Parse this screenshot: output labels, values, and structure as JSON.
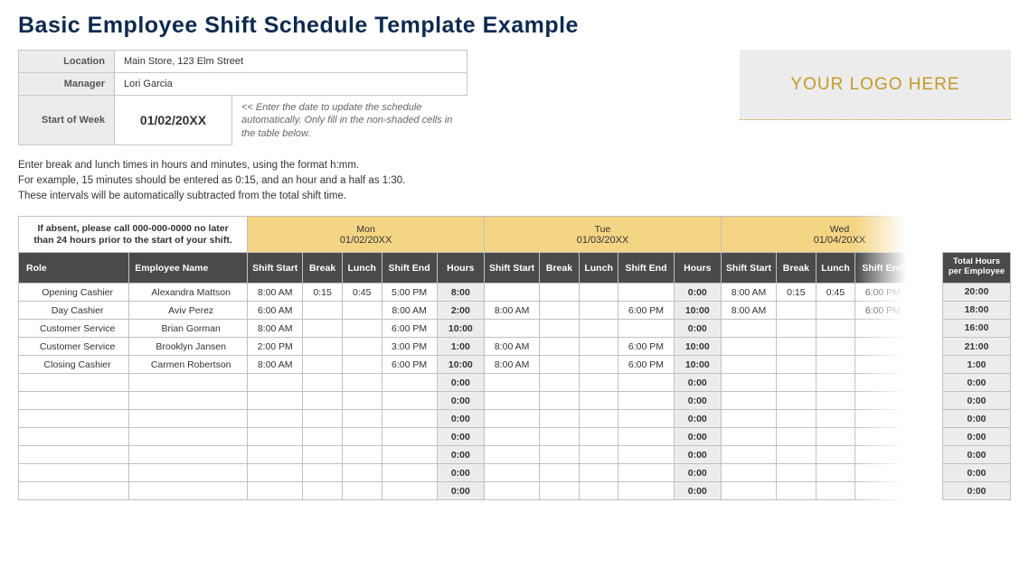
{
  "title": "Basic Employee Shift Schedule Template Example",
  "meta": {
    "location_label": "Location",
    "location": "Main Store, 123 Elm Street",
    "manager_label": "Manager",
    "manager": "Lori Garcia",
    "sow_label": "Start of Week",
    "sow": "01/02/20XX",
    "sow_hint": "<< Enter the date to update the schedule automatically. Only fill in the non-shaded cells in the table below."
  },
  "logo_text": "YOUR LOGO HERE",
  "instructions": [
    "Enter break and lunch times in hours and minutes, using the format h:mm.",
    "For example, 15 minutes should be entered as 0:15, and an hour and a half as 1:30.",
    "These intervals will be automatically subtracted from the total shift time."
  ],
  "notice": "If absent, please call 000-000-0000 no later than 24 hours prior to the start of your shift.",
  "col_labels": {
    "role": "Role",
    "employee": "Employee Name",
    "shift_start": "Shift Start",
    "break": "Break",
    "lunch": "Lunch",
    "shift_end": "Shift End",
    "hours": "Hours",
    "total": "Total Hours per Employee"
  },
  "days": [
    {
      "name": "Mon",
      "date": "01/02/20XX"
    },
    {
      "name": "Tue",
      "date": "01/03/20XX"
    },
    {
      "name": "Wed",
      "date": "01/04/20XX"
    }
  ],
  "rows": [
    {
      "role": "Opening Cashier",
      "employee": "Alexandra Mattson",
      "d": [
        {
          "ss": "8:00 AM",
          "b": "0:15",
          "l": "0:45",
          "se": "5:00 PM",
          "h": "8:00"
        },
        {
          "ss": "",
          "b": "",
          "l": "",
          "se": "",
          "h": "0:00"
        },
        {
          "ss": "8:00 AM",
          "b": "0:15",
          "l": "0:45",
          "se": "6:00 PM",
          "h": ""
        }
      ],
      "total": "20:00"
    },
    {
      "role": "Day Cashier",
      "employee": "Aviv Perez",
      "d": [
        {
          "ss": "6:00 AM",
          "b": "",
          "l": "",
          "se": "8:00 AM",
          "h": "2:00"
        },
        {
          "ss": "8:00 AM",
          "b": "",
          "l": "",
          "se": "6:00 PM",
          "h": "10:00"
        },
        {
          "ss": "8:00 AM",
          "b": "",
          "l": "",
          "se": "6:00 PM",
          "h": ""
        }
      ],
      "total": "18:00"
    },
    {
      "role": "Customer Service",
      "employee": "Brian Gorman",
      "d": [
        {
          "ss": "8:00 AM",
          "b": "",
          "l": "",
          "se": "6:00 PM",
          "h": "10:00"
        },
        {
          "ss": "",
          "b": "",
          "l": "",
          "se": "",
          "h": "0:00"
        },
        {
          "ss": "",
          "b": "",
          "l": "",
          "se": "",
          "h": ""
        }
      ],
      "total": "16:00"
    },
    {
      "role": "Customer Service",
      "employee": "Brooklyn Jansen",
      "d": [
        {
          "ss": "2:00 PM",
          "b": "",
          "l": "",
          "se": "3:00 PM",
          "h": "1:00"
        },
        {
          "ss": "8:00 AM",
          "b": "",
          "l": "",
          "se": "6:00 PM",
          "h": "10:00"
        },
        {
          "ss": "",
          "b": "",
          "l": "",
          "se": "",
          "h": ""
        }
      ],
      "total": "21:00"
    },
    {
      "role": "Closing Cashier",
      "employee": "Carmen Robertson",
      "d": [
        {
          "ss": "8:00 AM",
          "b": "",
          "l": "",
          "se": "6:00 PM",
          "h": "10:00"
        },
        {
          "ss": "8:00 AM",
          "b": "",
          "l": "",
          "se": "6:00 PM",
          "h": "10:00"
        },
        {
          "ss": "",
          "b": "",
          "l": "",
          "se": "",
          "h": ""
        }
      ],
      "total": "1:00"
    },
    {
      "role": "",
      "employee": "",
      "d": [
        {
          "ss": "",
          "b": "",
          "l": "",
          "se": "",
          "h": "0:00"
        },
        {
          "ss": "",
          "b": "",
          "l": "",
          "se": "",
          "h": "0:00"
        },
        {
          "ss": "",
          "b": "",
          "l": "",
          "se": "",
          "h": ""
        }
      ],
      "total": "0:00"
    },
    {
      "role": "",
      "employee": "",
      "d": [
        {
          "ss": "",
          "b": "",
          "l": "",
          "se": "",
          "h": "0:00"
        },
        {
          "ss": "",
          "b": "",
          "l": "",
          "se": "",
          "h": "0:00"
        },
        {
          "ss": "",
          "b": "",
          "l": "",
          "se": "",
          "h": ""
        }
      ],
      "total": "0:00"
    },
    {
      "role": "",
      "employee": "",
      "d": [
        {
          "ss": "",
          "b": "",
          "l": "",
          "se": "",
          "h": "0:00"
        },
        {
          "ss": "",
          "b": "",
          "l": "",
          "se": "",
          "h": "0:00"
        },
        {
          "ss": "",
          "b": "",
          "l": "",
          "se": "",
          "h": ""
        }
      ],
      "total": "0:00"
    },
    {
      "role": "",
      "employee": "",
      "d": [
        {
          "ss": "",
          "b": "",
          "l": "",
          "se": "",
          "h": "0:00"
        },
        {
          "ss": "",
          "b": "",
          "l": "",
          "se": "",
          "h": "0:00"
        },
        {
          "ss": "",
          "b": "",
          "l": "",
          "se": "",
          "h": ""
        }
      ],
      "total": "0:00"
    },
    {
      "role": "",
      "employee": "",
      "d": [
        {
          "ss": "",
          "b": "",
          "l": "",
          "se": "",
          "h": "0:00"
        },
        {
          "ss": "",
          "b": "",
          "l": "",
          "se": "",
          "h": "0:00"
        },
        {
          "ss": "",
          "b": "",
          "l": "",
          "se": "",
          "h": ""
        }
      ],
      "total": "0:00"
    },
    {
      "role": "",
      "employee": "",
      "d": [
        {
          "ss": "",
          "b": "",
          "l": "",
          "se": "",
          "h": "0:00"
        },
        {
          "ss": "",
          "b": "",
          "l": "",
          "se": "",
          "h": "0:00"
        },
        {
          "ss": "",
          "b": "",
          "l": "",
          "se": "",
          "h": ""
        }
      ],
      "total": "0:00"
    },
    {
      "role": "",
      "employee": "",
      "d": [
        {
          "ss": "",
          "b": "",
          "l": "",
          "se": "",
          "h": "0:00"
        },
        {
          "ss": "",
          "b": "",
          "l": "",
          "se": "",
          "h": "0:00"
        },
        {
          "ss": "",
          "b": "",
          "l": "",
          "se": "",
          "h": ""
        }
      ],
      "total": "0:00"
    }
  ]
}
